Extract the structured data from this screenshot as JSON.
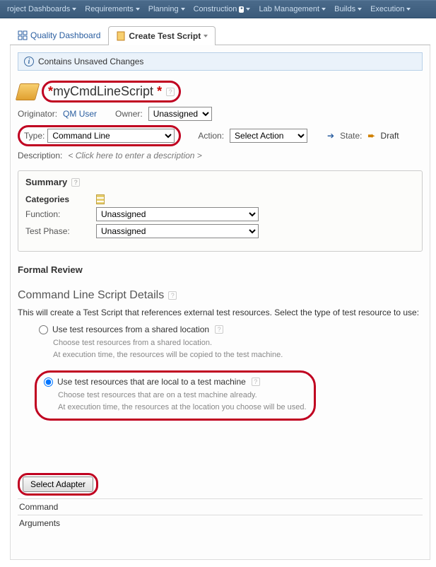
{
  "nav": {
    "items": [
      {
        "label": "roject Dashboards"
      },
      {
        "label": "Requirements"
      },
      {
        "label": "Planning"
      },
      {
        "label": "Construction",
        "badge": "*"
      },
      {
        "label": "Lab Management"
      },
      {
        "label": "Builds"
      },
      {
        "label": "Execution"
      }
    ]
  },
  "tabs": {
    "quality": "Quality Dashboard",
    "create": "Create Test Script"
  },
  "info_bar": "Contains Unsaved Changes",
  "title": {
    "star": "*",
    "name": "myCmdLineScript",
    "trailing_star": "*"
  },
  "meta": {
    "originator_label": "Originator:",
    "originator_value": "QM User",
    "owner_label": "Owner:",
    "owner_options": [
      "Unassigned"
    ],
    "type_label": "Type:",
    "type_options": [
      "Command Line"
    ],
    "action_label": "Action:",
    "action_options": [
      "Select Action"
    ],
    "state_label": "State:",
    "state_value": "Draft",
    "desc_label": "Description:",
    "desc_placeholder": "< Click here to enter a description >"
  },
  "summary": {
    "title": "Summary",
    "categories_label": "Categories",
    "function_label": "Function:",
    "function_options": [
      "Unassigned"
    ],
    "phase_label": "Test Phase:",
    "phase_options": [
      "Unassigned"
    ]
  },
  "formal_review": "Formal Review",
  "details": {
    "title": "Command Line Script Details",
    "intro": "This will create a Test Script that references external test resources. Select the type of test resource to use:",
    "opt1_label": "Use test resources from a shared location",
    "opt1_desc1": "Choose test resources from a shared location.",
    "opt1_desc2": "At execution time, the resources will be copied to the test machine.",
    "opt2_label": "Use test resources that are local to a test machine",
    "opt2_desc1": "Choose test resources that are on a test machine already.",
    "opt2_desc2": "At execution time, the resources at the location you choose will be used."
  },
  "adapter": {
    "button": "Select Adapter",
    "command_label": "Command",
    "arguments_label": "Arguments"
  }
}
